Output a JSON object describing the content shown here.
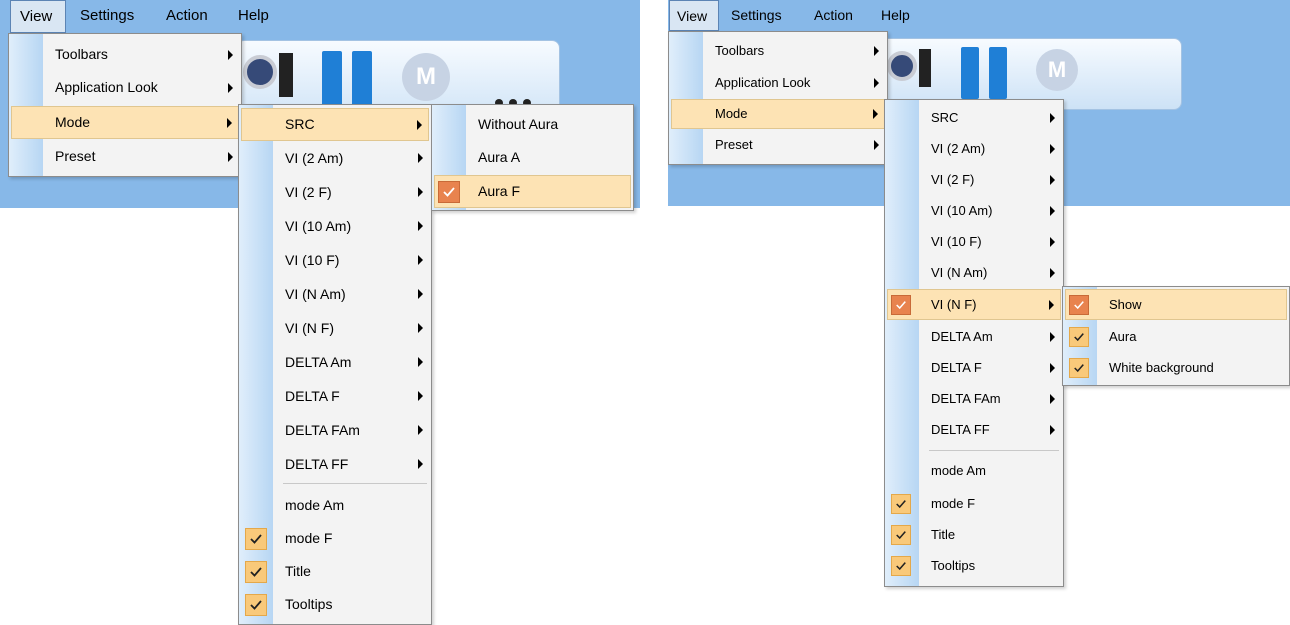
{
  "menubar": {
    "view": "View",
    "settings": "Settings",
    "action": "Action",
    "help": "Help"
  },
  "view_menu": {
    "toolbars": "Toolbars",
    "application_look": "Application Look",
    "mode": "Mode",
    "preset": "Preset"
  },
  "toolbar": {
    "m_button": "M"
  },
  "mode_menu": {
    "items": [
      "SRC",
      "VI (2 Am)",
      "VI (2 F)",
      "VI (10 Am)",
      "VI (10 F)",
      "VI (N Am)",
      "VI (N F)",
      "DELTA Am",
      "DELTA F",
      "DELTA FAm",
      "DELTA FF"
    ],
    "items_right": [
      "SRC",
      "VI (2 Am)",
      "VI (2 F)",
      "VI (10 Am)",
      "VI (10 F)",
      "VI (N Am)",
      "VI (N F)",
      "DELTA Am",
      "DELTA F",
      "DELTA FAm",
      "DELTA FF"
    ],
    "mode_am": "mode Am",
    "mode_f": "mode F",
    "title": "Title",
    "tooltips": "Tooltips"
  },
  "src_submenu": {
    "without_aura": "Without Aura",
    "aura_a": "Aura A",
    "aura_f": "Aura F"
  },
  "vinf_submenu": {
    "show": "Show",
    "aura": "Aura",
    "white_background": "White background"
  },
  "colors": {
    "menubar": "#87b8e8",
    "highlight": "#fde3b4",
    "check": "#f9c97a",
    "check_active": "#e8834e"
  }
}
